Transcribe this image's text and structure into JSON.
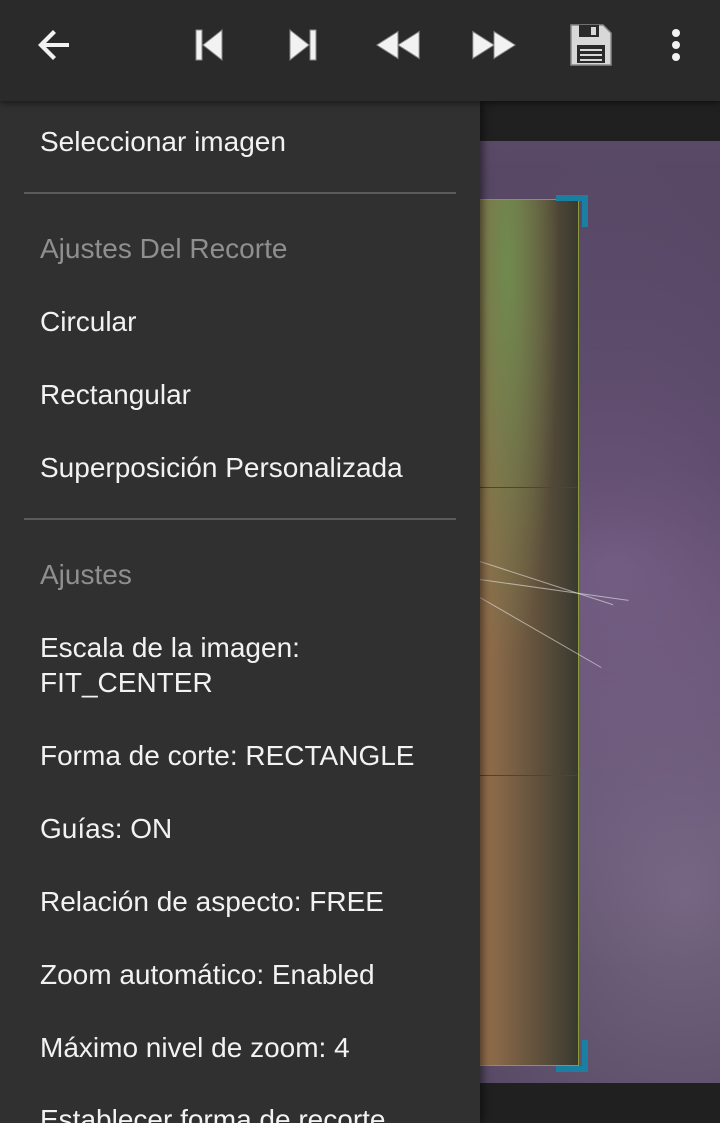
{
  "toolbar": {
    "back_icon": "arrow-back-icon",
    "icons": [
      "skip-previous-icon",
      "skip-next-icon",
      "rewind-icon",
      "fast-forward-icon",
      "save-icon",
      "more-vert-icon"
    ]
  },
  "drawer": {
    "select_image": "Seleccionar imagen",
    "crop_settings_header": "Ajustes Del Recorte",
    "crop_options": [
      "Circular",
      "Rectangular",
      "Superposición Personalizada"
    ],
    "settings_header": "Ajustes",
    "settings": [
      "Escala de la imagen: FIT_CENTER",
      "Forma de corte: RECTANGLE",
      "Guías: ON",
      "Relación de aspecto: FREE",
      "Zoom automático: Enabled",
      "Máximo nivel de zoom: 4",
      "Establecer forma de recorte"
    ]
  },
  "colors": {
    "toolbar_bg": "#2a2a2a",
    "drawer_bg": "#303030",
    "header_text": "#8f8f8f",
    "item_text": "#f2f2f2",
    "crop_handle": "#1a7fa0",
    "guideline": "#a02020"
  }
}
